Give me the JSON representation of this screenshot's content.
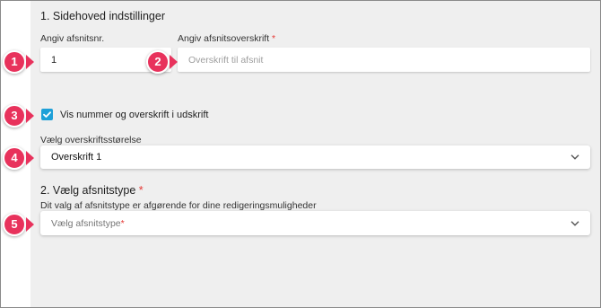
{
  "section1": {
    "title": "1. Sidehoved indstillinger",
    "number_label": "Angiv afsnitsnr.",
    "number_value": "1",
    "heading_label": "Angiv afsnitsoverskrift",
    "heading_required": "*",
    "heading_placeholder": "Overskrift til afsnit",
    "show_checkbox_label": "Vis nummer og overskrift i udskrift",
    "show_checkbox_checked": true,
    "size_label": "Vælg overskriftsstørelse",
    "size_value": "Overskrift 1"
  },
  "section2": {
    "title": "2. Vælg afsnitstype",
    "title_required": "*",
    "description": "Dit valg af afsnitstype er afgørende for dine redigeringsmuligheder",
    "type_placeholder": "Vælg afsnitstype",
    "type_required": "*"
  },
  "callouts": [
    "1",
    "2",
    "3",
    "4",
    "5"
  ],
  "colors": {
    "callout": "#e8325c",
    "checkbox": "#1ea0d8",
    "required": "#e53935",
    "panel": "#efefef"
  },
  "icons": {
    "checkbox": "check-icon",
    "select": "chevron-down-icon"
  }
}
